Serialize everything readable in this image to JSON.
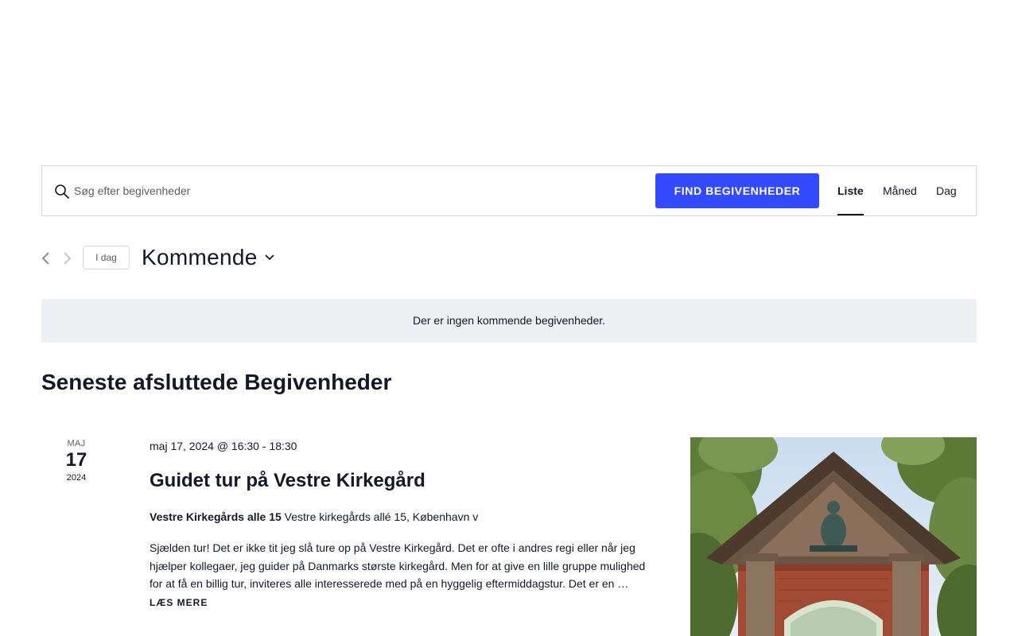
{
  "search": {
    "placeholder": "Søg efter begivenheder",
    "button_label": "Find begivenheder"
  },
  "views": [
    {
      "label": "Liste",
      "active": true
    },
    {
      "label": "Måned",
      "active": false
    },
    {
      "label": "Dag",
      "active": false
    }
  ],
  "nav": {
    "today_label": "I dag",
    "period_label": "Kommende"
  },
  "notice": "Der er ingen kommende begivenheder.",
  "past_heading": "Seneste afsluttede Begivenheder",
  "event": {
    "date_month": "MAJ",
    "date_day": "17",
    "date_year": "2024",
    "datetime_start": "maj 17, 2024 @ 16:30",
    "datetime_separator": "-",
    "datetime_end": "18:30",
    "title": "Guidet tur på Vestre Kirkegård",
    "venue_name": "Vestre Kirkegårds alle 15",
    "venue_address": "Vestre kirkegårds allé 15, København v",
    "description": "Sjælden tur! Det er ikke tit jeg slå ture op på Vestre Kirkegård. Det er ofte i andres regi eller når jeg hjælper kollegaer, jeg guider på Danmarks største kirkegård. Men for at give en lille gruppe mulighed for at få en billig tur, inviteres alle interesserede med på en hyggelig eftermiddagstur. Det er en …",
    "read_more_label": "Læs mere"
  },
  "colors": {
    "accent": "#334aff",
    "text": "#141827",
    "muted": "#5d5d5d",
    "notice_bg": "#eeeff2",
    "border": "#d5d5d5"
  },
  "icons": {
    "search": "search-icon",
    "prev": "chevron-left-icon",
    "next": "chevron-right-icon",
    "period_dropdown": "chevron-down-icon"
  }
}
